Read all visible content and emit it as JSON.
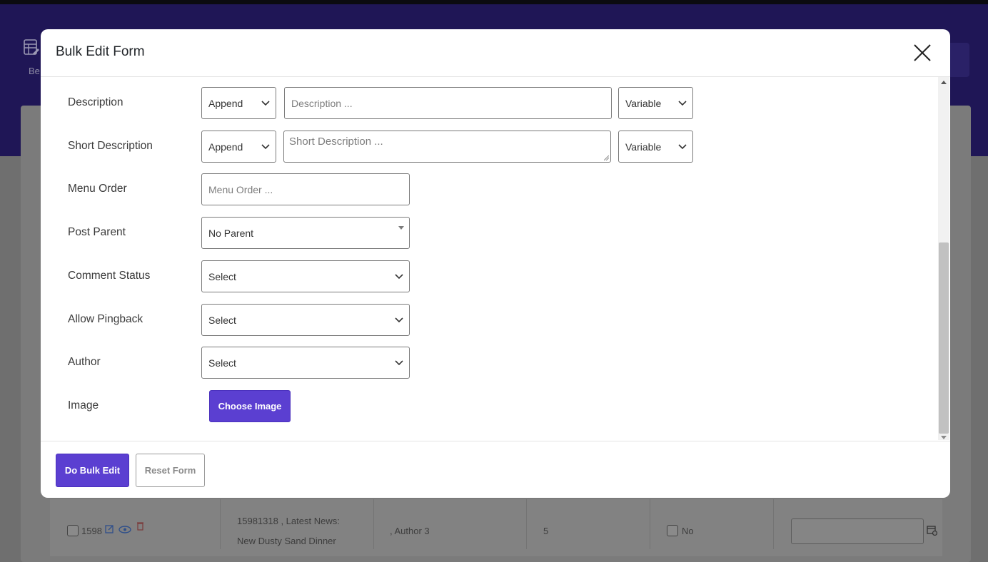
{
  "background": {
    "header_label": "Be",
    "row": {
      "id": "1598",
      "title_line1": "15981318 , Latest News:",
      "title_line2": "New Dusty Sand Dinner",
      "author": ", Author 3",
      "count": "5",
      "flag": "No"
    }
  },
  "modal": {
    "title": "Bulk Edit Form",
    "rows": [
      {
        "label": "Description",
        "mode": "Append",
        "placeholder": "Description ...",
        "variable": "Variable"
      },
      {
        "label": "Short Description",
        "mode": "Append",
        "placeholder": "Short Description ...",
        "variable": "Variable"
      },
      {
        "label": "Menu Order",
        "placeholder": "Menu Order ..."
      },
      {
        "label": "Post Parent",
        "value": "No Parent"
      },
      {
        "label": "Comment Status",
        "value": "Select"
      },
      {
        "label": "Allow Pingback",
        "value": "Select"
      },
      {
        "label": "Author",
        "value": "Select"
      },
      {
        "label": "Image",
        "button": "Choose Image"
      }
    ],
    "footer": {
      "primary": "Do Bulk Edit",
      "secondary": "Reset Form"
    }
  },
  "colors": {
    "accent": "#5b3fd1",
    "header_bg": "#1f1656"
  }
}
